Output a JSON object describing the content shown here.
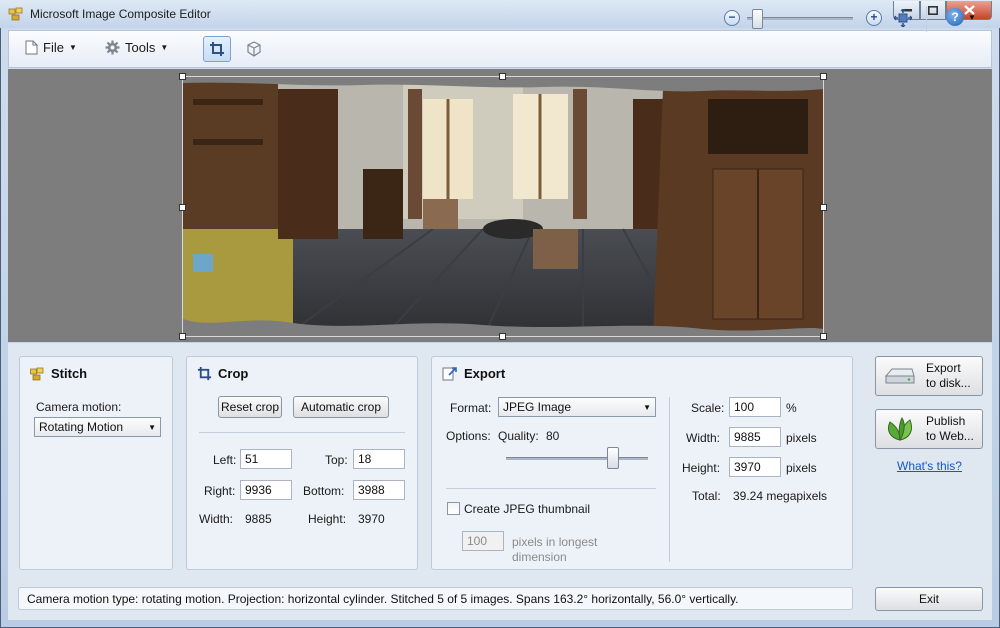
{
  "window": {
    "title": "Microsoft Image Composite Editor"
  },
  "toolbar": {
    "file_label": "File",
    "tools_label": "Tools",
    "zoom_level": 0.05
  },
  "stitch": {
    "title": "Stitch",
    "camera_motion_label": "Camera motion:",
    "camera_motion_value": "Rotating Motion"
  },
  "crop": {
    "title": "Crop",
    "reset_label": "Reset crop",
    "auto_label": "Automatic crop",
    "left_label": "Left:",
    "left_value": "51",
    "top_label": "Top:",
    "top_value": "18",
    "right_label": "Right:",
    "right_value": "9936",
    "bottom_label": "Bottom:",
    "bottom_value": "3988",
    "width_label": "Width:",
    "width_value": "9885",
    "height_label": "Height:",
    "height_value": "3970"
  },
  "export": {
    "title": "Export",
    "format_label": "Format:",
    "format_value": "JPEG Image",
    "options_label": "Options:",
    "quality_label": "Quality:",
    "quality_value": "80",
    "quality_level": 0.8,
    "thumbnail_label": "Create JPEG thumbnail",
    "thumbnail_checked": false,
    "thumb_pixels_value": "100",
    "thumb_pixels_label_1": "pixels in longest",
    "thumb_pixels_label_2": "dimension",
    "scale_label": "Scale:",
    "scale_value": "100",
    "scale_unit": "%",
    "width_label": "Width:",
    "width_value": "9885",
    "width_unit": "pixels",
    "height_label": "Height:",
    "height_value": "3970",
    "height_unit": "pixels",
    "total_label": "Total:",
    "total_value": "39.24 megapixels"
  },
  "actions": {
    "export_disk_1": "Export",
    "export_disk_2": "to disk...",
    "publish_web_1": "Publish",
    "publish_web_2": "to Web...",
    "whats_this": "What's this?",
    "exit_label": "Exit"
  },
  "status": {
    "text": "Camera motion type: rotating motion. Projection: horizontal cylinder. Stitched 5 of 5 images. Spans 163.2° horizontally, 56.0° vertically."
  }
}
